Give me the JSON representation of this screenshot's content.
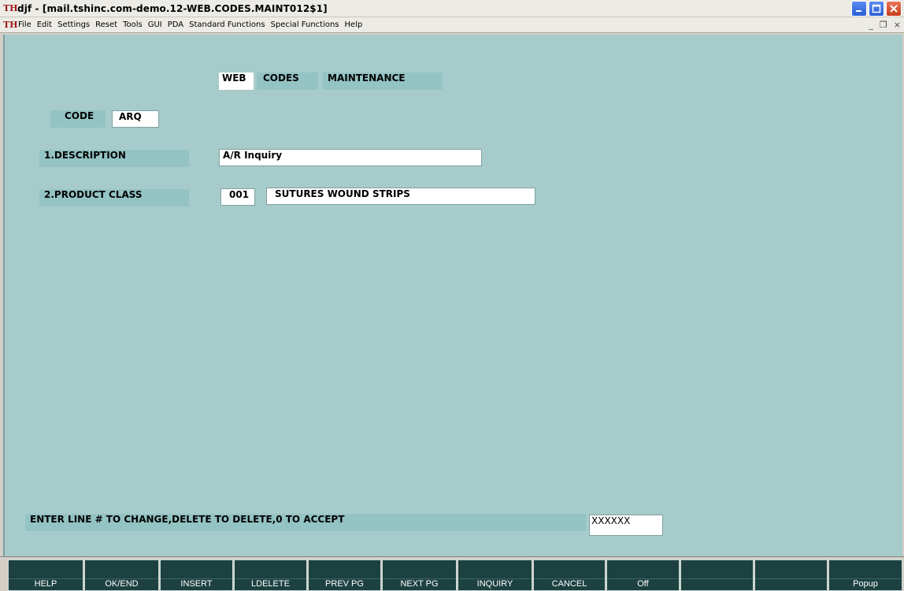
{
  "window": {
    "title": "djf - [mail.tshinc.com-demo.12-WEB.CODES.MAINT012$1]",
    "app_logo": "TH"
  },
  "menubar": {
    "items": [
      "File",
      "Edit",
      "Settings",
      "Reset",
      "Tools",
      "GUI",
      "PDA",
      "Standard Functions",
      "Special Functions",
      "Help"
    ],
    "mdi_minimize": "_",
    "mdi_restore": "❐",
    "mdi_close": "×"
  },
  "screen": {
    "title_web": "WEB",
    "title_codes": "CODES",
    "title_maint": "MAINTENANCE",
    "code_label": "CODE",
    "code_value": "ARQ",
    "description_label": "1.DESCRIPTION",
    "description_value": "A/R Inquiry",
    "product_class_label": "2.PRODUCT CLASS",
    "product_class_code": "001",
    "product_class_desc": "SUTURES WOUND STRIPS",
    "prompt": "ENTER LINE # TO CHANGE,DELETE TO DELETE,0 TO ACCEPT",
    "prompt_input": "XXXXXX"
  },
  "function_keys": [
    "HELP",
    "OK/END",
    "INSERT",
    "LDELETE",
    "PREV PG",
    "NEXT PG",
    "INQUIRY",
    "CANCEL",
    "Off",
    "",
    "",
    "Popup"
  ],
  "colors": {
    "screen_bg": "#a7cbcb",
    "label_bg": "#94c3c3",
    "fkey_bg": "#1d4141"
  }
}
